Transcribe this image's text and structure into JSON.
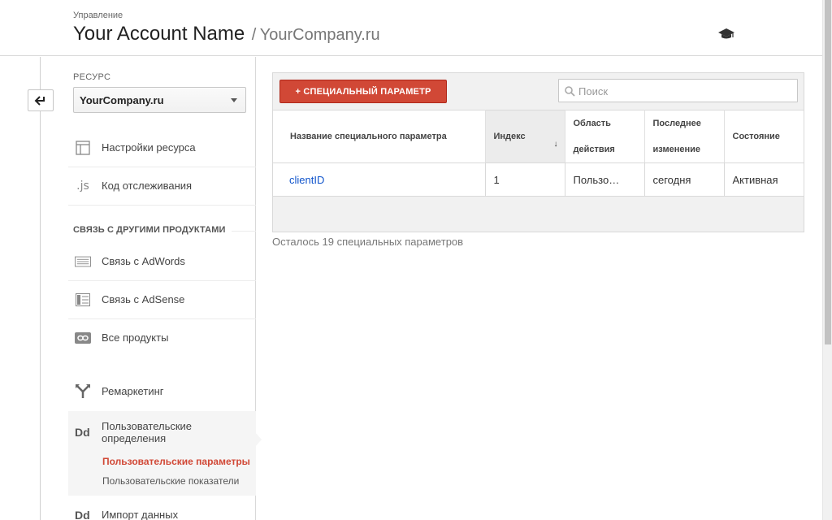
{
  "header": {
    "breadcrumb": "Управление",
    "account_name": "Your Account Name",
    "separator": "/",
    "company": "YourCompany.ru"
  },
  "sidebar": {
    "resource_label": "РЕСУРС",
    "resource_value": "YourCompany.ru",
    "items_top": [
      {
        "label": "Настройки ресурса",
        "icon": "window-icon"
      },
      {
        "label": "Код отслеживания",
        "icon": "js-icon",
        "icon_text": ".js"
      }
    ],
    "section_heading": "СВЯЗЬ С ДРУГИМИ ПРОДУКТАМИ",
    "items_links": [
      {
        "label": "Связь с AdWords",
        "icon": "adwords-icon"
      },
      {
        "label": "Связь с AdSense",
        "icon": "adsense-icon"
      },
      {
        "label": "Все продукты",
        "icon": "link-icon"
      }
    ],
    "remarketing": {
      "label": "Ремаркетинг",
      "icon": "fork-icon"
    },
    "custom_definitions": {
      "icon_text": "Dd",
      "label": "Пользовательские определения",
      "sub_active": "Пользовательские параметры",
      "sub_other": "Пользовательские показатели"
    },
    "data_import": {
      "icon_text": "Dd",
      "label": "Импорт данных"
    }
  },
  "toolbar": {
    "add_button": "+ СПЕЦИАЛЬНЫЙ ПАРАМЕТР",
    "search_placeholder": "Поиск"
  },
  "table": {
    "headers": [
      "Название специального параметра",
      "Индекс",
      "Область действия",
      "Последнее изменение",
      "Состояние"
    ],
    "sort_indicator": "↓",
    "rows": [
      [
        "clientID",
        "1",
        "Пользо…",
        "сегодня",
        "Активная"
      ]
    ]
  },
  "footer": {
    "remaining": "Осталось 19 специальных параметров"
  },
  "colors": {
    "accent_red": "#d14836",
    "link_blue": "#15c"
  }
}
